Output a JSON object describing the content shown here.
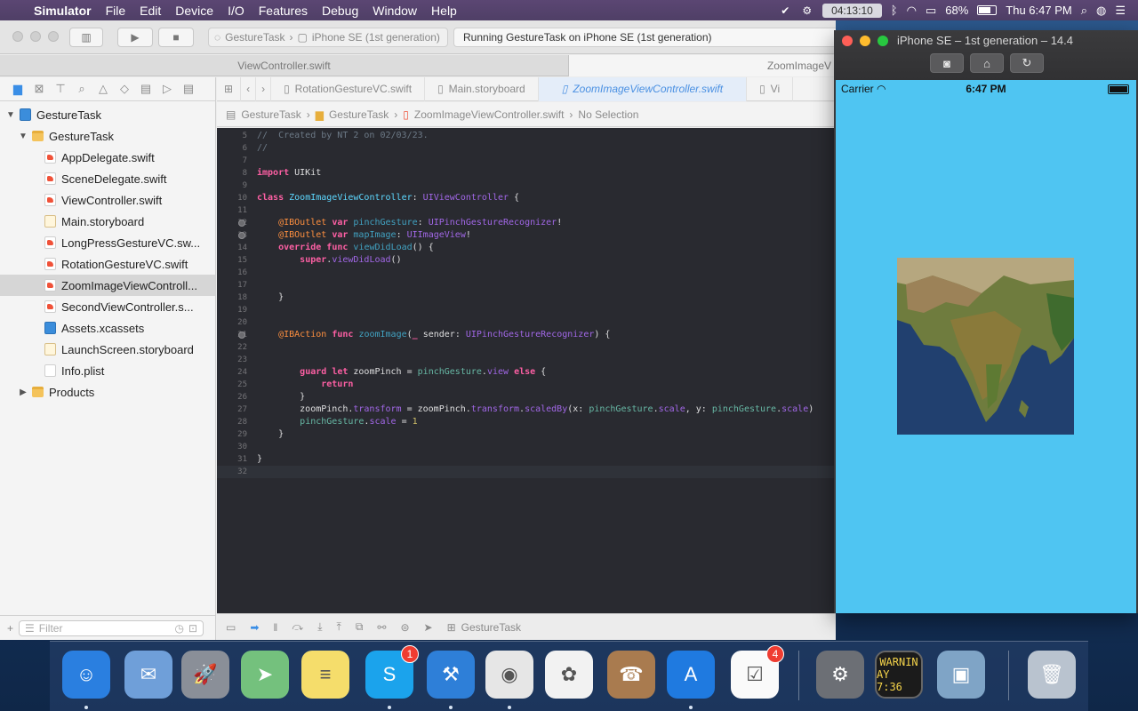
{
  "menubar": {
    "app": "Simulator",
    "items": [
      "File",
      "Edit",
      "Device",
      "I/O",
      "Features",
      "Debug",
      "Window",
      "Help"
    ],
    "timer": "04:13:10",
    "battery": "68%",
    "clock": "Thu 6:47 PM"
  },
  "toolbar": {
    "scheme": "GestureTask",
    "device": "iPhone SE (1st generation)",
    "status": "Running GestureTask on iPhone SE (1st generation)"
  },
  "tabs": [
    "ViewController.swift",
    "ZoomImageV"
  ],
  "navigator": {
    "items": [
      {
        "label": "GestureTask",
        "type": "project",
        "indent": 0,
        "disc": "▼"
      },
      {
        "label": "GestureTask",
        "type": "folder",
        "indent": 1,
        "disc": "▼"
      },
      {
        "label": "AppDelegate.swift",
        "type": "swift",
        "indent": 2
      },
      {
        "label": "SceneDelegate.swift",
        "type": "swift",
        "indent": 2
      },
      {
        "label": "ViewController.swift",
        "type": "swift",
        "indent": 2
      },
      {
        "label": "Main.storyboard",
        "type": "sb",
        "indent": 2
      },
      {
        "label": "LongPressGestureVC.sw...",
        "type": "swift",
        "indent": 2
      },
      {
        "label": "RotationGestureVC.swift",
        "type": "swift",
        "indent": 2
      },
      {
        "label": "ZoomImageViewControll...",
        "type": "swift",
        "indent": 2,
        "selected": true
      },
      {
        "label": "SecondViewController.s...",
        "type": "swift",
        "indent": 2
      },
      {
        "label": "Assets.xcassets",
        "type": "assets",
        "indent": 2
      },
      {
        "label": "LaunchScreen.storyboard",
        "type": "sb",
        "indent": 2
      },
      {
        "label": "Info.plist",
        "type": "plist",
        "indent": 2
      },
      {
        "label": "Products",
        "type": "folder",
        "indent": 1,
        "disc": "▶"
      }
    ],
    "filter_placeholder": "Filter"
  },
  "jumpbar": {
    "tabs": [
      "RotationGestureVC.swift",
      "Main.storyboard",
      "ZoomImageViewController.swift",
      "Vi"
    ]
  },
  "breadcrumbs": [
    "GestureTask",
    "GestureTask",
    "ZoomImageViewController.swift",
    "No Selection"
  ],
  "code": [
    {
      "n": "5",
      "html": "<span class=\"c\">//  Created by NT 2 on 02/03/23.</span>"
    },
    {
      "n": "6",
      "html": "<span class=\"c\">//</span>"
    },
    {
      "n": "7",
      "html": ""
    },
    {
      "n": "8",
      "html": "<span class=\"k\">import</span> UIKit"
    },
    {
      "n": "9",
      "html": ""
    },
    {
      "n": "10",
      "html": "<span class=\"k\">class</span> <span class=\"t\">ZoomImageViewController</span>: <span class=\"m\">UIViewController</span> {"
    },
    {
      "n": "11",
      "html": ""
    },
    {
      "n": "12",
      "bp": true,
      "html": "    <span class=\"a\">@IBOutlet</span> <span class=\"k\">var</span> <span class=\"f\">pinchGesture</span>: <span class=\"m\">UIPinchGestureRecognizer</span>!"
    },
    {
      "n": "13",
      "bp": true,
      "html": "    <span class=\"a\">@IBOutlet</span> <span class=\"k\">var</span> <span class=\"f\">mapImage</span>: <span class=\"m\">UIImageView</span>!"
    },
    {
      "n": "14",
      "html": "    <span class=\"k\">override</span> <span class=\"k\">func</span> <span class=\"f\">viewDidLoad</span>() {"
    },
    {
      "n": "15",
      "html": "        <span class=\"k\">super</span>.<span class=\"m\">viewDidLoad</span>()"
    },
    {
      "n": "16",
      "html": ""
    },
    {
      "n": "17",
      "html": ""
    },
    {
      "n": "18",
      "html": "    }"
    },
    {
      "n": "19",
      "html": ""
    },
    {
      "n": "20",
      "html": ""
    },
    {
      "n": "21",
      "bp": true,
      "html": "    <span class=\"a\">@IBAction</span> <span class=\"k\">func</span> <span class=\"f\">zoomImage</span>(<span class=\"k\">_</span> sender: <span class=\"m\">UIPinchGestureRecognizer</span>) {"
    },
    {
      "n": "22",
      "html": ""
    },
    {
      "n": "23",
      "html": ""
    },
    {
      "n": "24",
      "html": "        <span class=\"k\">guard</span> <span class=\"k\">let</span> zoomPinch = <span class=\"p\">pinchGesture</span>.<span class=\"m\">view</span> <span class=\"k\">else</span> {"
    },
    {
      "n": "25",
      "html": "            <span class=\"k\">return</span>"
    },
    {
      "n": "26",
      "html": "        }"
    },
    {
      "n": "27",
      "html": "        zoomPinch.<span class=\"m\">transform</span> = zoomPinch.<span class=\"m\">transform</span>.<span class=\"m\">scaledBy</span>(x: <span class=\"p\">pinchGesture</span>.<span class=\"m\">scale</span>, y: <span class=\"p\">pinchGesture</span>.<span class=\"m\">scale</span>)"
    },
    {
      "n": "28",
      "html": "        <span class=\"p\">pinchGesture</span>.<span class=\"m\">scale</span> = <span class=\"n\">1</span>"
    },
    {
      "n": "29",
      "html": "    }"
    },
    {
      "n": "30",
      "html": ""
    },
    {
      "n": "31",
      "html": "}"
    },
    {
      "n": "32",
      "html": "",
      "cur": true
    }
  ],
  "debugbar": {
    "target": "GestureTask"
  },
  "simulator": {
    "title": "iPhone SE – 1st generation – 14.4",
    "carrier": "Carrier",
    "time": "6:47 PM"
  },
  "dock": [
    {
      "name": "finder-app-icon",
      "bg": "#2a7fe0",
      "glyph": "☺"
    },
    {
      "name": "mail-app-icon",
      "bg": "#6f9fd9",
      "glyph": "✉"
    },
    {
      "name": "launchpad-app-icon",
      "bg": "#8a8f98",
      "glyph": "🚀"
    },
    {
      "name": "maps-app-icon",
      "bg": "#74c17d",
      "glyph": "➤"
    },
    {
      "name": "notes-app-icon",
      "bg": "#f5dd6b",
      "glyph": "≡"
    },
    {
      "name": "skype-app-icon",
      "bg": "#1ba3ec",
      "glyph": "S",
      "badge": "1"
    },
    {
      "name": "xcode-app-icon",
      "bg": "#2e7fd8",
      "glyph": "⚒"
    },
    {
      "name": "chrome-app-icon",
      "bg": "#e6e6e6",
      "glyph": "◉"
    },
    {
      "name": "photos-app-icon",
      "bg": "#f2f2f2",
      "glyph": "✿"
    },
    {
      "name": "contacts-app-icon",
      "bg": "#a97b4f",
      "glyph": "☎"
    },
    {
      "name": "simulator-app-icon",
      "bg": "#1f7ae0",
      "glyph": "A"
    },
    {
      "name": "reminders-app-icon",
      "bg": "#fafafa",
      "glyph": "☑",
      "badge": "4"
    },
    {
      "name": "system-preferences-app-icon",
      "bg": "#6c6f75",
      "glyph": "⚙"
    },
    {
      "name": "console-app-icon",
      "bg": "#1b1b1b",
      "glyph": "WARNI"
    },
    {
      "name": "preview-app-icon",
      "bg": "#7fa4c6",
      "glyph": "▣"
    },
    {
      "name": "trash-icon",
      "bg": "#b9c3cf",
      "glyph": "🗑"
    }
  ],
  "dock_console_text": [
    "WARNIN",
    "AY 7:36"
  ]
}
